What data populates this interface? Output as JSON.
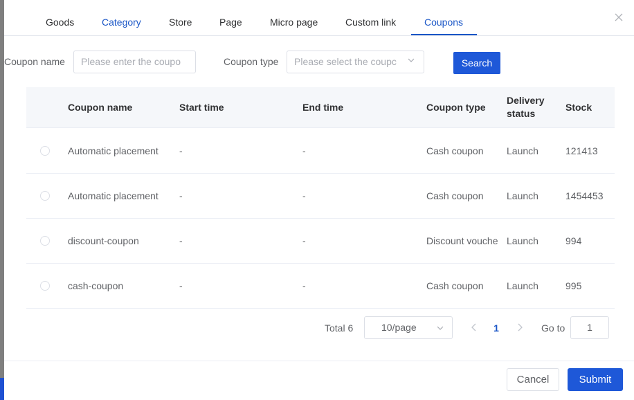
{
  "tabs": [
    {
      "label": "Goods"
    },
    {
      "label": "Category"
    },
    {
      "label": "Store"
    },
    {
      "label": "Page"
    },
    {
      "label": "Micro page"
    },
    {
      "label": "Custom link"
    },
    {
      "label": "Coupons"
    }
  ],
  "active_tab": "Coupons",
  "filters": {
    "coupon_name_label": "Coupon name",
    "coupon_name_placeholder": "Please enter the coupo",
    "coupon_type_label": "Coupon type",
    "coupon_type_placeholder": "Please select the coupc",
    "search_label": "Search"
  },
  "table": {
    "headers": {
      "name": "Coupon name",
      "start": "Start time",
      "end": "End time",
      "type": "Coupon type",
      "delivery_line1": "Delivery",
      "delivery_line2": "status",
      "stock": "Stock"
    },
    "rows": [
      {
        "name": "Automatic placement",
        "start": "-",
        "end": "-",
        "type": "Cash coupon",
        "delivery": "Launch",
        "stock": "121413"
      },
      {
        "name": "Automatic placement",
        "start": "-",
        "end": "-",
        "type": "Cash coupon",
        "delivery": "Launch",
        "stock": "1454453"
      },
      {
        "name": "discount-coupon",
        "start": "-",
        "end": "-",
        "type": "Discount vouche",
        "delivery": "Launch",
        "stock": "994"
      },
      {
        "name": "cash-coupon",
        "start": "-",
        "end": "-",
        "type": "Cash coupon",
        "delivery": "Launch",
        "stock": "995"
      }
    ]
  },
  "pagination": {
    "total": "Total 6",
    "page_size": "10/page",
    "current_page": "1",
    "goto_label": "Go to",
    "goto_value": "1"
  },
  "footer": {
    "cancel_label": "Cancel",
    "submit_label": "Submit"
  },
  "colors": {
    "accent": "#1a56c7",
    "primary_button": "#1e58d8"
  },
  "icons": {
    "close": "close-icon",
    "select": "chevron-down-icon",
    "prev": "chevron-left-icon",
    "next": "chevron-right-icon"
  }
}
